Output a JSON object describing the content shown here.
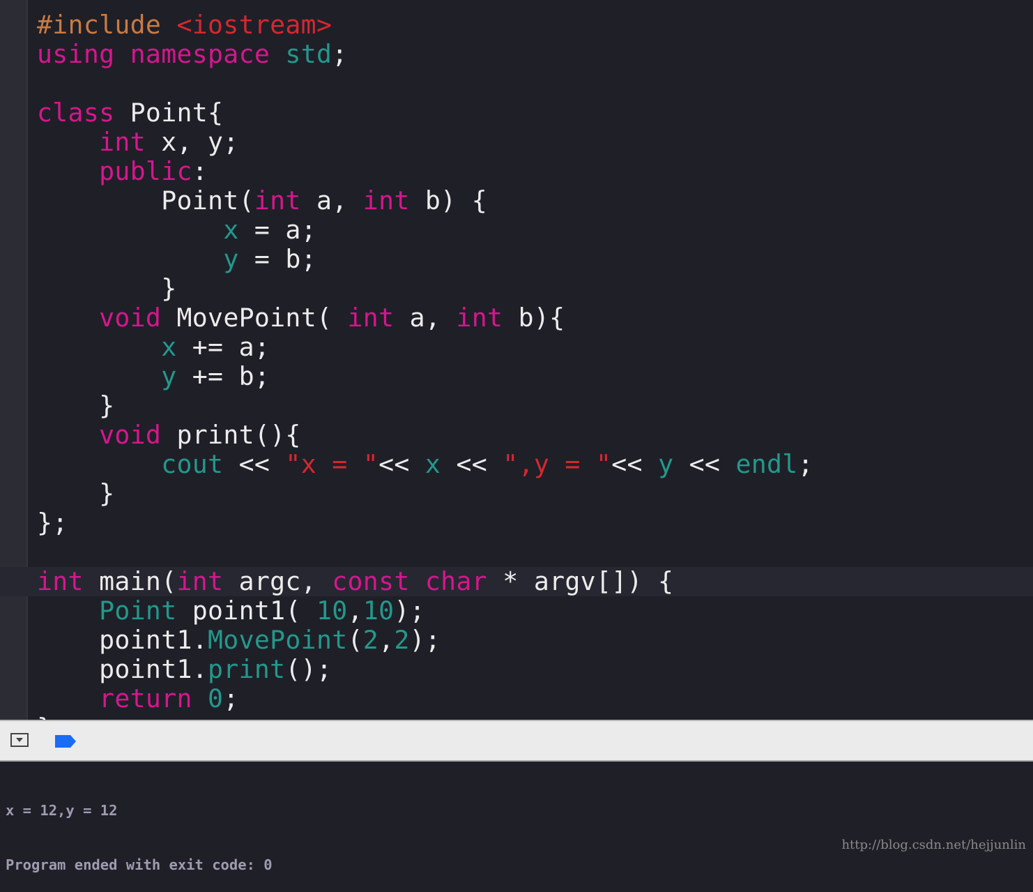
{
  "colors": {
    "keyword": "#d6168e",
    "preprocessor": "#c87b42",
    "string": "#d4282e",
    "identifier": "#22998c",
    "plain": "#ececec",
    "background": "#1f1f28",
    "breakpoint": "#1a6cf5"
  },
  "editor": {
    "highlighted_line": 19,
    "lines": [
      [
        [
          "pp",
          "#include "
        ],
        [
          "str",
          "<iostream>"
        ]
      ],
      [
        [
          "kw",
          "using"
        ],
        [
          "pl",
          " "
        ],
        [
          "kw",
          "namespace"
        ],
        [
          "pl",
          " "
        ],
        [
          "tl",
          "std"
        ],
        [
          "pl",
          ";"
        ]
      ],
      [],
      [
        [
          "kw",
          "class"
        ],
        [
          "pl",
          " Point{"
        ]
      ],
      [
        [
          "pl",
          "    "
        ],
        [
          "kw",
          "int"
        ],
        [
          "pl",
          " x, y;"
        ]
      ],
      [
        [
          "pl",
          "    "
        ],
        [
          "kw",
          "public"
        ],
        [
          "pl",
          ":"
        ]
      ],
      [
        [
          "pl",
          "        Point("
        ],
        [
          "kw",
          "int"
        ],
        [
          "pl",
          " a, "
        ],
        [
          "kw",
          "int"
        ],
        [
          "pl",
          " b) {"
        ]
      ],
      [
        [
          "pl",
          "            "
        ],
        [
          "tl",
          "x"
        ],
        [
          "pl",
          " = a;"
        ]
      ],
      [
        [
          "pl",
          "            "
        ],
        [
          "tl",
          "y"
        ],
        [
          "pl",
          " = b;"
        ]
      ],
      [
        [
          "pl",
          "        }"
        ]
      ],
      [
        [
          "pl",
          "    "
        ],
        [
          "kw",
          "void"
        ],
        [
          "pl",
          " MovePoint( "
        ],
        [
          "kw",
          "int"
        ],
        [
          "pl",
          " a, "
        ],
        [
          "kw",
          "int"
        ],
        [
          "pl",
          " b){"
        ]
      ],
      [
        [
          "pl",
          "        "
        ],
        [
          "tl",
          "x"
        ],
        [
          "pl",
          " += a;"
        ]
      ],
      [
        [
          "pl",
          "        "
        ],
        [
          "tl",
          "y"
        ],
        [
          "pl",
          " += b;"
        ]
      ],
      [
        [
          "pl",
          "    }"
        ]
      ],
      [
        [
          "pl",
          "    "
        ],
        [
          "kw",
          "void"
        ],
        [
          "pl",
          " print(){"
        ]
      ],
      [
        [
          "pl",
          "        "
        ],
        [
          "tl",
          "cout"
        ],
        [
          "pl",
          " << "
        ],
        [
          "str",
          "\"x = \""
        ],
        [
          "pl",
          "<< "
        ],
        [
          "tl",
          "x"
        ],
        [
          "pl",
          " << "
        ],
        [
          "str",
          "\",y = \""
        ],
        [
          "pl",
          "<< "
        ],
        [
          "tl",
          "y"
        ],
        [
          "pl",
          " << "
        ],
        [
          "tl",
          "endl"
        ],
        [
          "pl",
          ";"
        ]
      ],
      [
        [
          "pl",
          "    }"
        ]
      ],
      [
        [
          "pl",
          "};"
        ]
      ],
      [],
      [
        [
          "kw",
          "int"
        ],
        [
          "pl",
          " main("
        ],
        [
          "kw",
          "int"
        ],
        [
          "pl",
          " argc, "
        ],
        [
          "kw",
          "const"
        ],
        [
          "pl",
          " "
        ],
        [
          "kw",
          "char"
        ],
        [
          "pl",
          " * argv[]) {"
        ]
      ],
      [
        [
          "pl",
          "    "
        ],
        [
          "tl",
          "Point"
        ],
        [
          "pl",
          " point1( "
        ],
        [
          "tl",
          "10"
        ],
        [
          "pl",
          ","
        ],
        [
          "tl",
          "10"
        ],
        [
          "pl",
          ");"
        ]
      ],
      [
        [
          "pl",
          "    point1."
        ],
        [
          "tl",
          "MovePoint"
        ],
        [
          "pl",
          "("
        ],
        [
          "tl",
          "2"
        ],
        [
          "pl",
          ","
        ],
        [
          "tl",
          "2"
        ],
        [
          "pl",
          ");"
        ]
      ],
      [
        [
          "pl",
          "    point1."
        ],
        [
          "tl",
          "print"
        ],
        [
          "pl",
          "();"
        ]
      ],
      [
        [
          "pl",
          "    "
        ],
        [
          "kw",
          "return"
        ],
        [
          "pl",
          " "
        ],
        [
          "tl",
          "0"
        ],
        [
          "pl",
          ";"
        ]
      ],
      [
        [
          "pl",
          "}"
        ]
      ]
    ]
  },
  "toolbar": {
    "hide_icon": "hide-debug-area-icon",
    "breakpoint_icon": "breakpoint-toggle-icon"
  },
  "console": {
    "lines": [
      "x = 12,y = 12",
      "Program ended with exit code: 0"
    ]
  },
  "watermark": "http://blog.csdn.net/hejjunlin"
}
